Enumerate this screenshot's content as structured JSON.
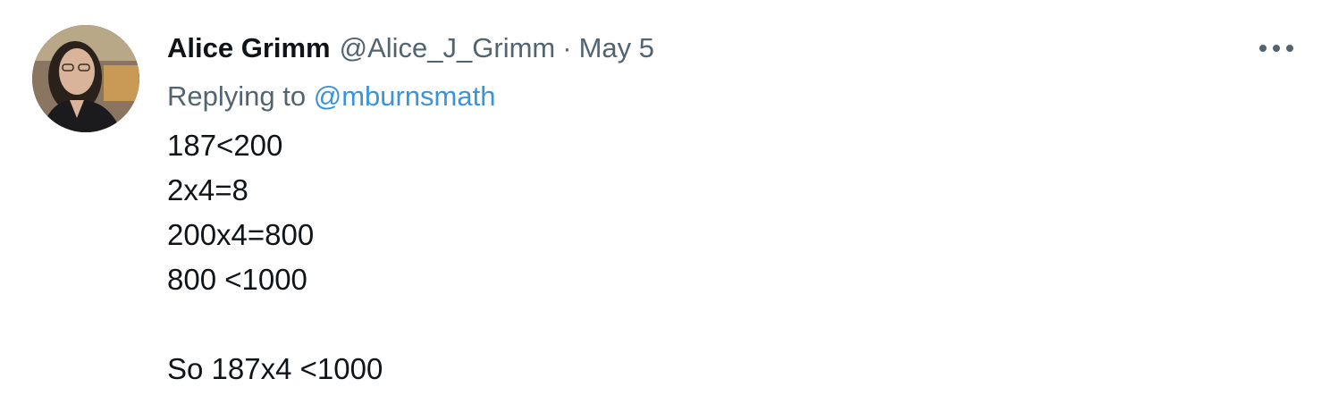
{
  "tweet": {
    "display_name": "Alice Grimm",
    "handle": "@Alice_J_Grimm",
    "separator": "·",
    "date": "May 5",
    "replying_prefix": "Replying to ",
    "replying_mention": "@mburnsmath",
    "body_lines": [
      "187<200",
      "2x4=8",
      "200x4=800",
      "800 <1000",
      "",
      "So 187x4 <1000"
    ],
    "icons": {
      "more": "more-horizontal-icon",
      "avatar": "user-avatar"
    },
    "colors": {
      "name": "#0f1419",
      "secondary": "#536471",
      "link": "#3b94d9"
    }
  }
}
